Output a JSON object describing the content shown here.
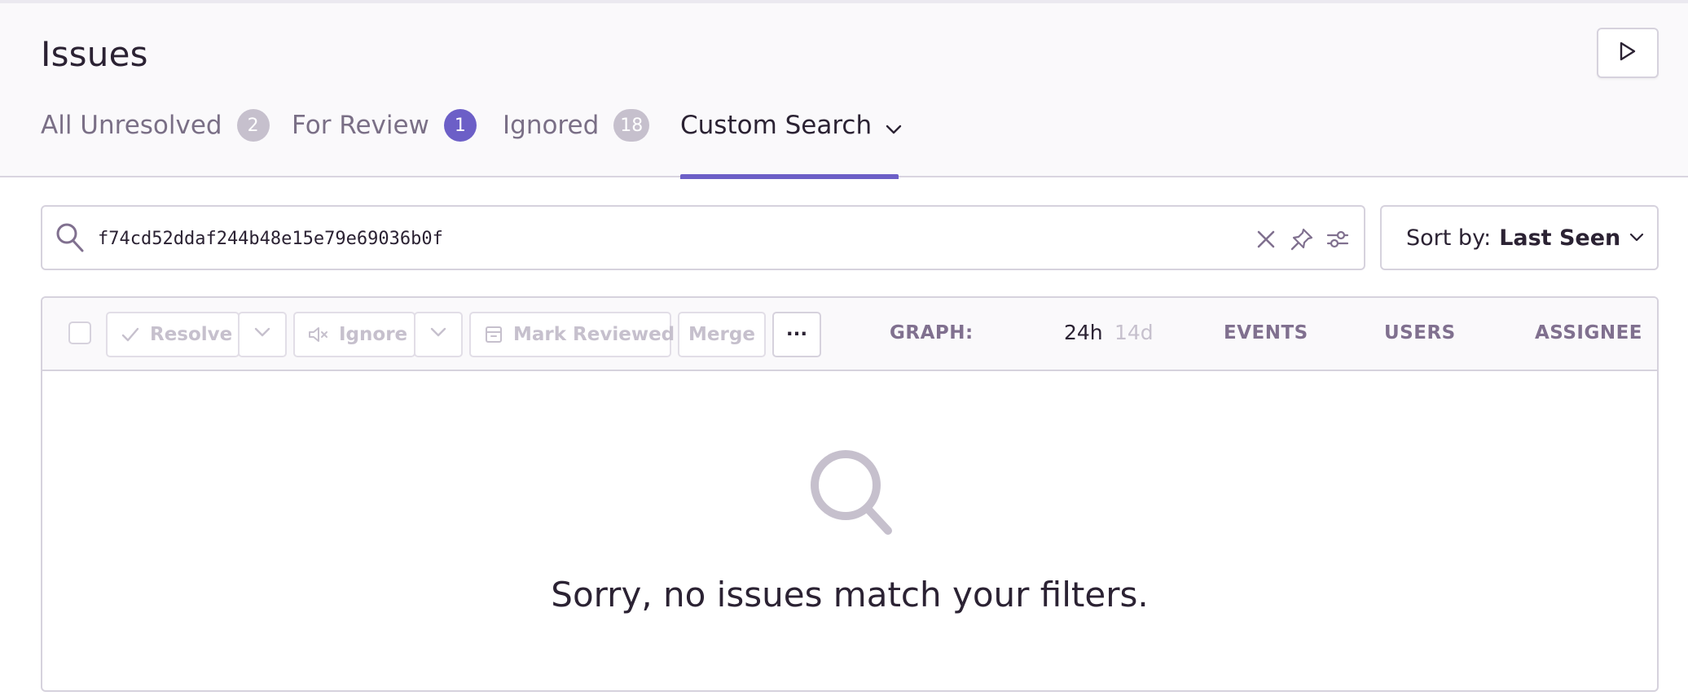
{
  "page": {
    "title": "Issues"
  },
  "header": {
    "play_button_icon": "play-icon"
  },
  "tabs": [
    {
      "label": "All Unresolved",
      "count": "2",
      "active": false
    },
    {
      "label": "For Review",
      "count": "1",
      "active": false,
      "badge_color": "#6c5fc7"
    },
    {
      "label": "Ignored",
      "count": "18",
      "active": false
    },
    {
      "label": "Custom Search",
      "active": true,
      "icon": "chevron-down-icon"
    }
  ],
  "search": {
    "value": "f74cd52ddaf244b48e15e79e69036b0f",
    "icons": [
      "search-icon",
      "close-icon",
      "pin-icon",
      "sliders-icon"
    ]
  },
  "sort": {
    "label": "Sort by:",
    "value": "Last Seen"
  },
  "toolbar": {
    "resolve_label": "Resolve",
    "ignore_label": "Ignore",
    "mark_reviewed_label": "Mark Reviewed",
    "merge_label": "Merge",
    "more_label": "···"
  },
  "columns": {
    "graph_label": "GRAPH:",
    "graph_options": [
      "24h",
      "14d"
    ],
    "graph_selected": "24h",
    "events": "EVENTS",
    "users": "USERS",
    "assignee": "ASSIGNEE"
  },
  "empty_state": {
    "message": "Sorry, no issues match your filters.",
    "icon": "search-icon"
  },
  "colors": {
    "accent": "#6c5fc7",
    "border": "#d6d2dd",
    "muted": "#c6c0cd",
    "text": "#2b2233"
  }
}
